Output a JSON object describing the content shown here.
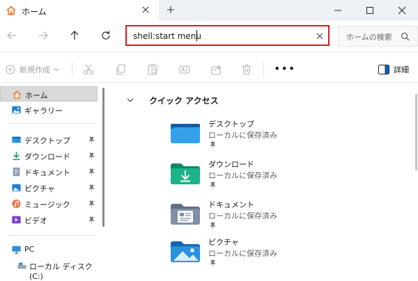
{
  "tab": {
    "title": "ホーム"
  },
  "address": {
    "value": "shell:start menu"
  },
  "search": {
    "placeholder": "ホームの検索"
  },
  "toolbar": {
    "new_label": "新規作成",
    "details_label": "詳細"
  },
  "sidebar": {
    "top": [
      {
        "label": "ホーム",
        "icon": "home-icon"
      },
      {
        "label": "ギャラリー",
        "icon": "gallery-icon"
      }
    ],
    "pinned": [
      {
        "label": "デスクトップ",
        "icon": "desktop-icon"
      },
      {
        "label": "ダウンロード",
        "icon": "download-icon"
      },
      {
        "label": "ドキュメント",
        "icon": "documents-icon"
      },
      {
        "label": "ピクチャ",
        "icon": "pictures-icon"
      },
      {
        "label": "ミュージック",
        "icon": "music-icon"
      },
      {
        "label": "ビデオ",
        "icon": "videos-icon"
      }
    ],
    "pc": {
      "label": "PC"
    },
    "drive": {
      "label": "ローカル ディスク (C:)"
    }
  },
  "quick_access": {
    "header": "クイック アクセス",
    "items": [
      {
        "name": "デスクトップ",
        "sub": "ローカルに保存済み",
        "icon": "desktop-folder-icon"
      },
      {
        "name": "ダウンロード",
        "sub": "ローカルに保存済み",
        "icon": "download-folder-icon"
      },
      {
        "name": "ドキュメント",
        "sub": "ローカルに保存済み",
        "icon": "documents-folder-icon"
      },
      {
        "name": "ピクチャ",
        "sub": "ローカルに保存済み",
        "icon": "pictures-folder-icon"
      }
    ]
  },
  "colors": {
    "address_border": "#e2141f",
    "accent": "#0067c0",
    "home_icon": "#e8772e"
  }
}
